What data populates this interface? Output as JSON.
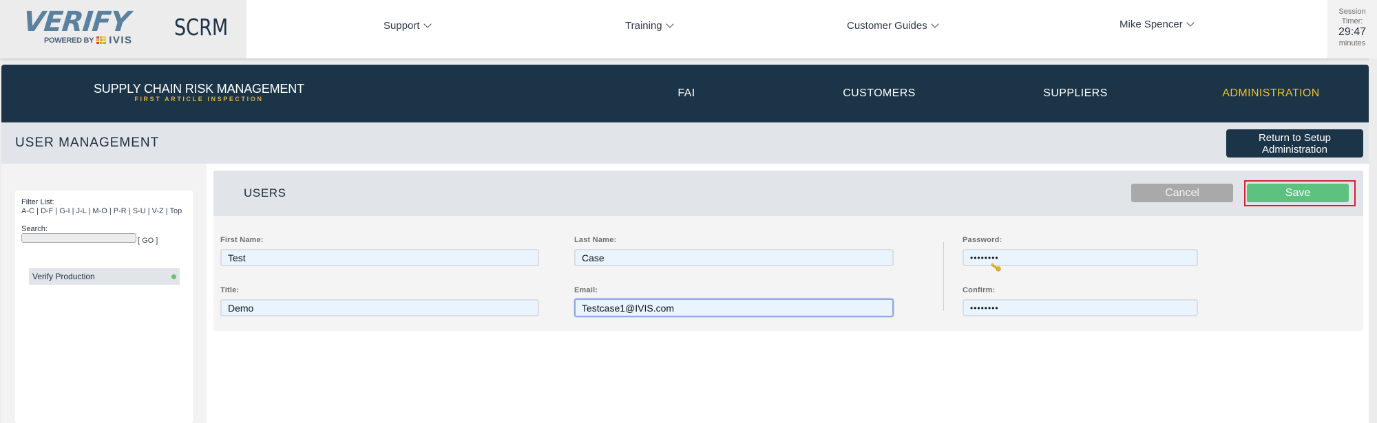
{
  "header": {
    "logo": {
      "brand": "VERIFY",
      "powered_by": "POWERED BY",
      "company": "IVIS"
    },
    "product": "SCRM",
    "nav": [
      {
        "label": "Support",
        "icon": "chevron-down-icon"
      },
      {
        "label": "Training",
        "icon": "chevron-down-icon"
      },
      {
        "label": "Customer Guides",
        "icon": "chevron-down-icon"
      }
    ],
    "user": {
      "name": "Mike Spencer",
      "icon": "chevron-down-icon"
    },
    "session": {
      "label": "Session Timer:",
      "time": "29:47",
      "unit": "minutes"
    }
  },
  "mainnav": {
    "title": "SUPPLY CHAIN RISK MANAGEMENT",
    "subtitle": "FIRST ARTICLE INSPECTION",
    "tabs": [
      {
        "label": "FAI",
        "active": false
      },
      {
        "label": "CUSTOMERS",
        "active": false
      },
      {
        "label": "SUPPLIERS",
        "active": false
      },
      {
        "label": "ADMINISTRATION",
        "active": true
      }
    ]
  },
  "section": {
    "title": "USER MANAGEMENT",
    "return_button": "Return to Setup Administration"
  },
  "sidebar": {
    "filter_label": "Filter List:",
    "filters": [
      "A-C",
      "D-F",
      "G-I",
      "J-L",
      "M-O",
      "P-R",
      "S-U",
      "V-Z",
      "Top"
    ],
    "search_label": "Search:",
    "search_value": "",
    "go_label": "[ GO ]",
    "items": [
      {
        "label": "Verify Production",
        "status": "active"
      }
    ]
  },
  "users": {
    "title": "USERS",
    "cancel_label": "Cancel",
    "save_label": "Save",
    "fields": {
      "first_name": {
        "label": "First Name:",
        "value": "Test"
      },
      "last_name": {
        "label": "Last Name:",
        "value": "Case"
      },
      "title": {
        "label": "Title:",
        "value": "Demo"
      },
      "email": {
        "label": "Email:",
        "value": "Testcase1@IVIS.com"
      },
      "password": {
        "label": "Password:",
        "value": "••••••••"
      },
      "confirm": {
        "label": "Confirm:",
        "value": "••••••••"
      }
    }
  },
  "colors": {
    "navy": "#1b3448",
    "gold": "#f0c12c",
    "save_green": "#5dc180",
    "cancel_gray": "#a9a9a9",
    "highlight_red": "#d6202f",
    "status_green": "#6cc070"
  }
}
